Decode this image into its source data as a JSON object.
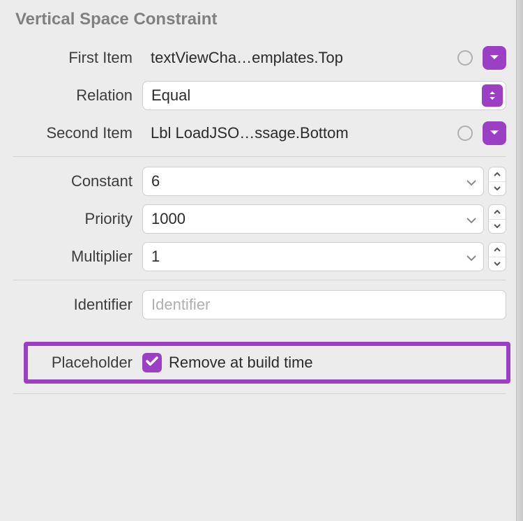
{
  "section": {
    "title": "Vertical Space Constraint"
  },
  "labels": {
    "first_item": "First Item",
    "relation": "Relation",
    "second_item": "Second Item",
    "constant": "Constant",
    "priority": "Priority",
    "multiplier": "Multiplier",
    "identifier": "Identifier",
    "placeholder": "Placeholder"
  },
  "values": {
    "first_item": "textViewCha…emplates.Top",
    "relation": "Equal",
    "second_item": "Lbl LoadJSO…ssage.Bottom",
    "constant": "6",
    "priority": "1000",
    "multiplier": "1",
    "identifier": "",
    "remove_at_build_time_checked": true,
    "remove_at_build_time_label": "Remove at build time"
  },
  "placeholders": {
    "identifier": "Identifier"
  },
  "colors": {
    "accent": "#9b3fc4",
    "bg": "#ececec",
    "border": "#cfcfcf"
  }
}
